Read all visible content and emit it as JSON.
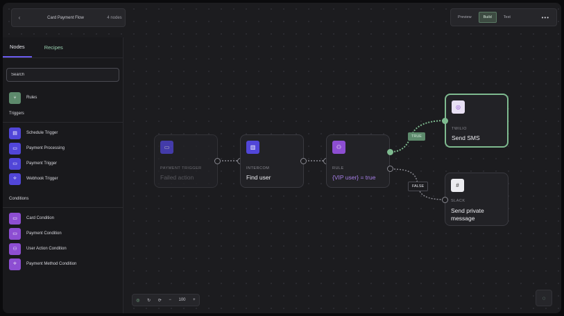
{
  "header": {
    "back_icon": "‹",
    "flow_name": "Card Payment Flow",
    "node_count": "4 nodes"
  },
  "toolbar": {
    "buttons": [
      "Preview",
      "Build",
      "Test"
    ],
    "active": "Build",
    "more": "•••"
  },
  "sidebar": {
    "tabs": [
      "Nodes",
      "Recipes"
    ],
    "search_placeholder": "Search",
    "rules": {
      "label": "Rules",
      "icon": "rule-icon"
    },
    "triggers_title": "Triggers",
    "triggers": [
      {
        "label": "Schedule Trigger",
        "icon": "calendar-icon"
      },
      {
        "label": "Payment Processing",
        "icon": "card-icon"
      },
      {
        "label": "Payment Trigger",
        "icon": "card-icon"
      },
      {
        "label": "Webhook Trigger",
        "icon": "webhook-icon"
      }
    ],
    "conditions_title": "Conditions",
    "conditions": [
      {
        "label": "Card Condition",
        "icon": "card-icon"
      },
      {
        "label": "Payment Condition",
        "icon": "card-icon"
      },
      {
        "label": "User Action Condition",
        "icon": "users-icon"
      },
      {
        "label": "Payment Method Condition",
        "icon": "webhook-icon"
      }
    ]
  },
  "nodes": {
    "payment": {
      "kind": "PAYMENT TRIGGER",
      "title": "Failed action"
    },
    "intercom": {
      "kind": "INTERCOM",
      "title": "Find user"
    },
    "rule": {
      "kind": "RULE",
      "title": "{VIP user} = true"
    },
    "twilio": {
      "kind": "TWILIO",
      "title": "Send SMS"
    },
    "slack": {
      "kind": "SLACK",
      "title_line1": "Send private",
      "title_line2": "message"
    }
  },
  "edges": {
    "true_label": "TRUE",
    "false_label": "FALSE"
  },
  "controls": [
    "↻",
    "⟳",
    "−",
    "100",
    "+"
  ],
  "colors": {
    "accent": "#6b5cf0",
    "success": "#7fbb90",
    "trigger": "#5146d8",
    "condition": "#8d4ed2"
  }
}
